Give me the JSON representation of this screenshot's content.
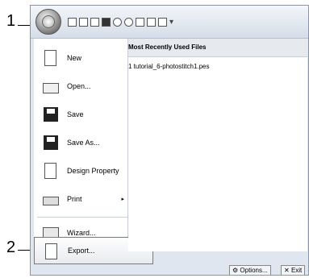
{
  "callouts": [
    "1",
    "2"
  ],
  "qat_icons": [
    "new-icon",
    "open-icon",
    "save-icon",
    "paint-icon",
    "hoop-icon",
    "circle-icon",
    "zoom-icon",
    "undo-icon",
    "redo-icon",
    "customize-icon"
  ],
  "menu": {
    "items": [
      {
        "label": "New",
        "icon": "new-document-icon"
      },
      {
        "label": "Open...",
        "icon": "open-folder-icon"
      },
      {
        "label": "Save",
        "icon": "save-disk-icon"
      },
      {
        "label": "Save As...",
        "icon": "save-as-icon"
      },
      {
        "label": "Design Property",
        "icon": "design-property-icon"
      },
      {
        "label": "Print",
        "icon": "printer-icon"
      },
      {
        "label": "Wizard...",
        "icon": "wizard-icon"
      }
    ],
    "export_label": "Export...",
    "print_submenu_arrow": "▸"
  },
  "recent": {
    "title": "Most Recently Used Files",
    "files": [
      "1 tutorial_6-photostitch1.pes"
    ]
  },
  "footer": {
    "options_label": "Options...",
    "exit_label": "Exit"
  }
}
